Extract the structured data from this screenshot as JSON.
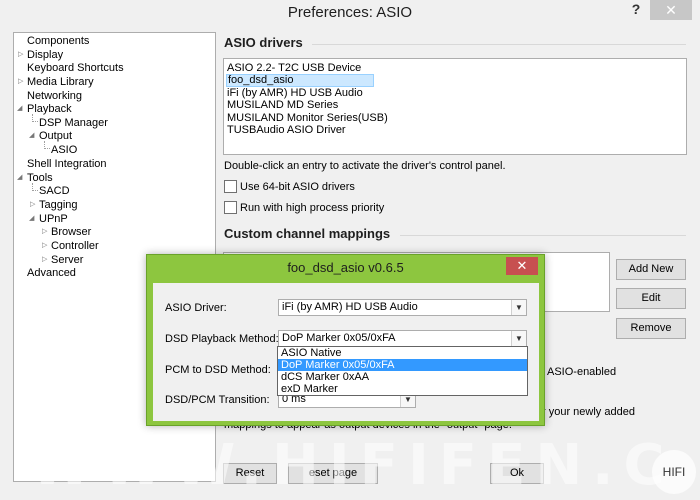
{
  "window": {
    "title": "Preferences: ASIO",
    "help_label": "?",
    "close_label": "✕"
  },
  "tree": {
    "items": [
      "Components",
      "Display",
      "Keyboard Shortcuts",
      "Media Library",
      "Networking",
      "Playback",
      "DSP Manager",
      "Output",
      "ASIO",
      "Shell Integration",
      "Tools",
      "SACD",
      "Tagging",
      "UPnP",
      "Browser",
      "Controller",
      "Server",
      "Advanced"
    ]
  },
  "asio": {
    "heading": "ASIO drivers",
    "drivers": [
      "ASIO 2.2- T2C USB Device",
      "foo_dsd_asio",
      "iFi (by AMR) HD USB Audio",
      "MUSILAND MD Series",
      "MUSILAND Monitor Series(USB)",
      "TUSBAudio ASIO Driver"
    ],
    "selected_driver": "foo_dsd_asio",
    "hint": "Double-click an entry to activate the driver's control panel.",
    "use64_label": "Use 64-bit ASIO drivers",
    "priority_label": "Run with high process priority"
  },
  "mappings": {
    "heading": "Custom channel mappings",
    "add_label": "Add New",
    "edit_label": "Edit",
    "remove_label": "Remove",
    "desc_tail1": "ASIO-enabled",
    "desc_tail2": "r your newly added",
    "desc_line3": "mappings to appear as output devices in the \"output\" page."
  },
  "bottom": {
    "reset_label": "Reset",
    "reset_page_label": "eset page",
    "ok_label": "Ok"
  },
  "dialog": {
    "title": "foo_dsd_asio v0.6.5",
    "close_label": "✕",
    "asio_driver_label": "ASIO Driver:",
    "asio_driver_value": "iFi (by AMR) HD USB Audio",
    "dsd_method_label": "DSD Playback Method:",
    "dsd_method_value": "DoP Marker 0x05/0xFA",
    "pcm_method_label": "PCM to DSD Method:",
    "transition_label": "DSD/PCM Transition:",
    "transition_value": "0 ms",
    "dropdown_options": [
      "ASIO Native",
      "DoP Marker 0x05/0xFA",
      "dCS Marker 0xAA",
      "exD Marker"
    ],
    "dropdown_selected": "DoP Marker 0x05/0xFA"
  },
  "watermark": {
    "text": "WWW.HIFIFEN.COM",
    "logo_text": "HIFI"
  }
}
